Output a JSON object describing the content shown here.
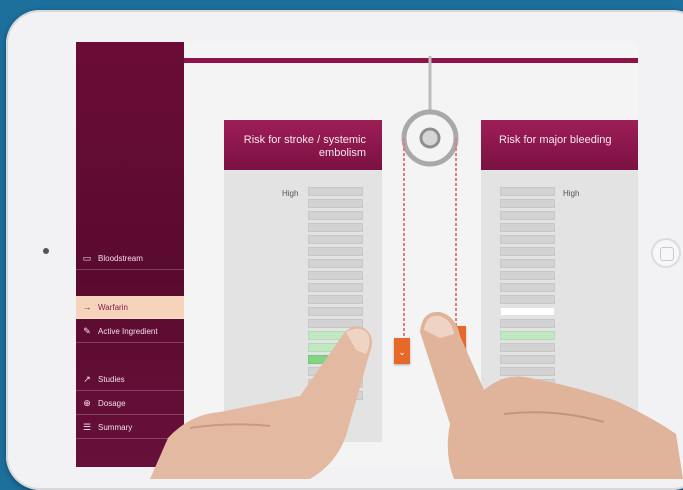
{
  "sidebar": {
    "items": [
      {
        "label": "Bloodstream",
        "icon": "bloodstream-icon",
        "active": false
      },
      {
        "label": "Warfarin",
        "icon": "arrow-right-icon",
        "active": true
      },
      {
        "label": "Active Ingredient",
        "icon": "active-ingredient-icon",
        "active": false
      },
      {
        "label": "Studies",
        "icon": "studies-icon",
        "active": false
      },
      {
        "label": "Dosage",
        "icon": "dosage-icon",
        "active": false
      },
      {
        "label": "Summary",
        "icon": "summary-icon",
        "active": false
      }
    ]
  },
  "panels": {
    "left": {
      "title": "Risk for stroke / systemic embolism",
      "level_label": "High",
      "bars": [
        "gray",
        "gray",
        "gray",
        "gray",
        "gray",
        "gray",
        "gray",
        "gray",
        "gray",
        "gray",
        "gray",
        "gray",
        "light-green",
        "light-green",
        "green",
        "gray",
        "gray",
        "gray"
      ]
    },
    "right": {
      "title": "Risk for major bleeding",
      "level_label": "High",
      "bars": [
        "gray",
        "gray",
        "gray",
        "gray",
        "gray",
        "gray",
        "gray",
        "gray",
        "gray",
        "gray",
        "white",
        "gray",
        "light-green",
        "gray",
        "gray",
        "gray",
        "gray",
        "gray"
      ]
    }
  },
  "handles": {
    "glyph": "⌄"
  },
  "colors": {
    "brand": "#7a1142",
    "accent": "#e7692a",
    "background": "#1d6f9c",
    "active_nav": "#f6d4bc",
    "bar_green": "#84d488"
  }
}
